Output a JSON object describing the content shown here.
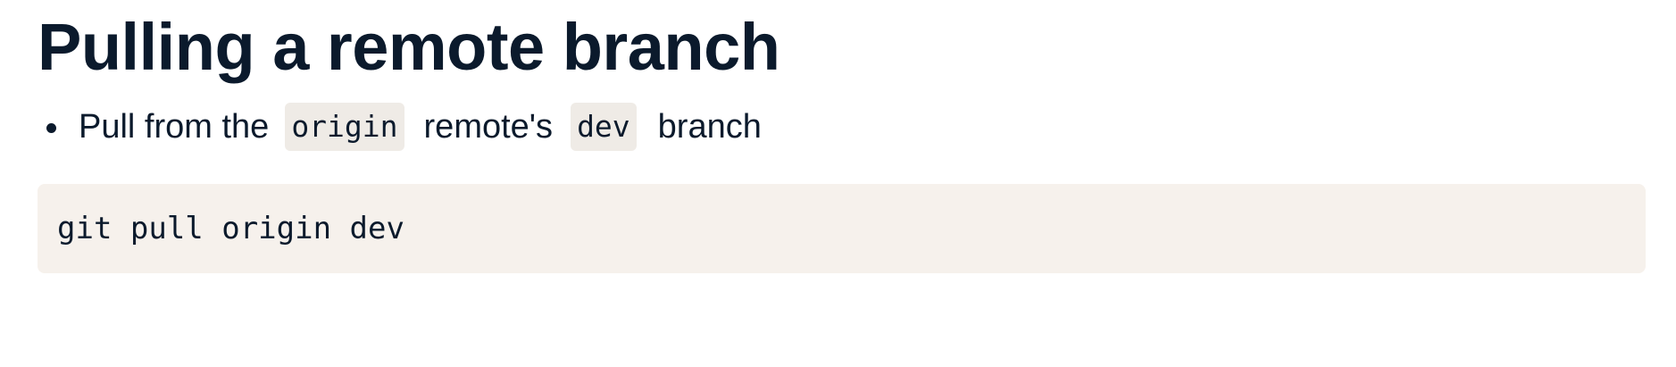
{
  "heading": {
    "title": "Pulling a remote branch"
  },
  "bullets": [
    {
      "text_1": "Pull from the",
      "code_1": "origin",
      "text_2": "remote's",
      "code_2": "dev",
      "text_3": "branch"
    }
  ],
  "code_block": {
    "command": "git pull origin dev"
  },
  "colors": {
    "text": "#0b1a2c",
    "inline_code_bg": "#efebe6",
    "code_block_bg": "#f6f1ec",
    "page_bg": "#ffffff"
  }
}
